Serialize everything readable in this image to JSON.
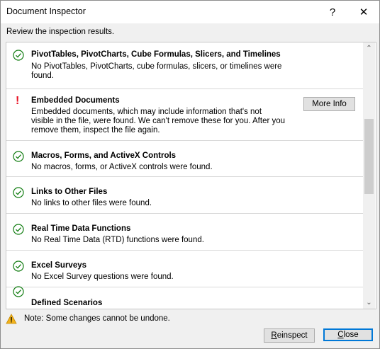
{
  "window": {
    "title": "Document Inspector",
    "help_glyph": "?",
    "close_glyph": "✕"
  },
  "subtitle": "Review the inspection results.",
  "items": [
    {
      "status": "ok",
      "title": "PivotTables, PivotCharts, Cube Formulas, Slicers, and Timelines",
      "desc": "No PivotTables, PivotCharts, cube formulas, slicers, or timelines were found."
    },
    {
      "status": "warning",
      "title": "Embedded Documents",
      "desc": "Embedded documents, which may include information that's not visible in the file, were found. We can't remove these for you. After you remove them, inspect the file again.",
      "button": "More Info",
      "status_glyph": "!"
    },
    {
      "status": "ok",
      "title": "Macros, Forms, and ActiveX Controls",
      "desc": "No macros, forms, or ActiveX controls were found."
    },
    {
      "status": "ok",
      "title": "Links to Other Files",
      "desc": "No links to other files were found."
    },
    {
      "status": "ok",
      "title": "Real Time Data Functions",
      "desc": "No Real Time Data (RTD) functions were found."
    },
    {
      "status": "ok",
      "title": "Excel Surveys",
      "desc": "No Excel Survey questions were found."
    },
    {
      "status": "ok",
      "title": "Defined Scenarios",
      "desc": ""
    }
  ],
  "scroll_up_glyph": "⌃",
  "scroll_down_glyph": "⌄",
  "note": "Note: Some changes cannot be undone.",
  "buttons": {
    "reinspect_first": "R",
    "reinspect_rest": "einspect",
    "close_first": "C",
    "close_rest": "lose"
  },
  "colors": {
    "ok_icon": "#107c10",
    "warning": "#e81123",
    "note_icon": "#f2b21b",
    "focus_border": "#0078d7"
  }
}
